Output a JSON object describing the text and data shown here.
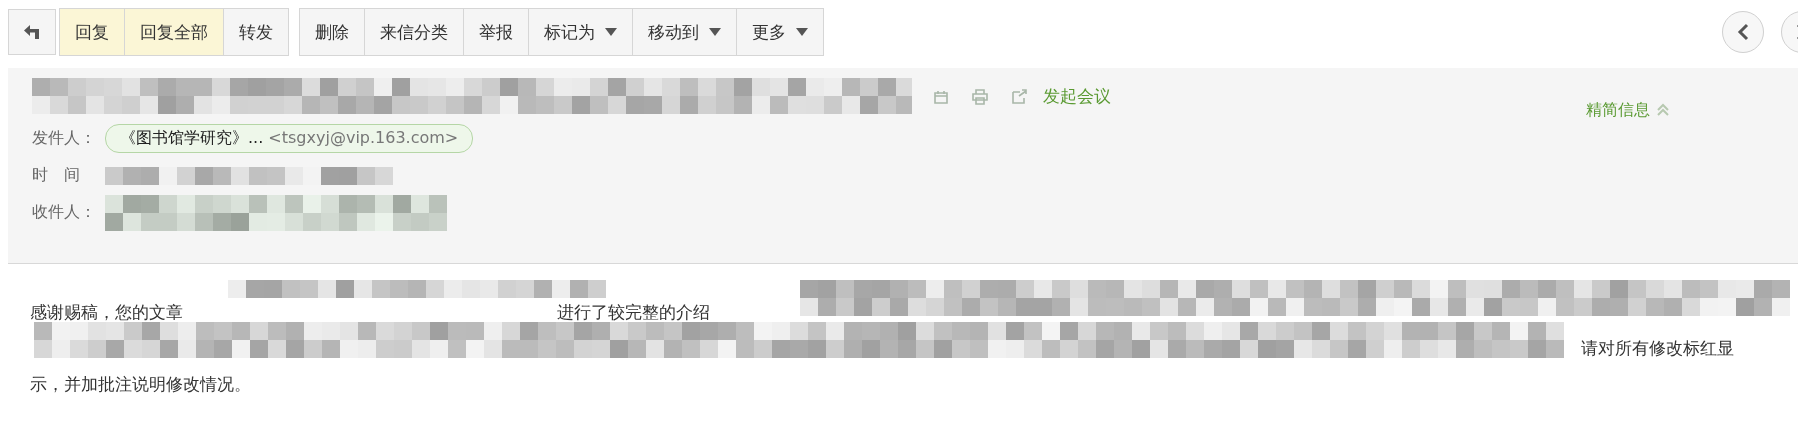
{
  "toolbar": {
    "groups": [
      [
        {
          "label": "回复",
          "highlighted": true,
          "dropdown": false
        },
        {
          "label": "回复全部",
          "highlighted": true,
          "dropdown": false
        },
        {
          "label": "转发",
          "highlighted": false,
          "dropdown": false
        }
      ],
      [
        {
          "label": "删除",
          "highlighted": false,
          "dropdown": false
        },
        {
          "label": "来信分类",
          "highlighted": false,
          "dropdown": false
        },
        {
          "label": "举报",
          "highlighted": false,
          "dropdown": false
        },
        {
          "label": "标记为",
          "highlighted": false,
          "dropdown": true
        },
        {
          "label": "移动到",
          "highlighted": false,
          "dropdown": true
        },
        {
          "label": "更多",
          "highlighted": false,
          "dropdown": true
        }
      ]
    ]
  },
  "header": {
    "meeting_link": "发起会议",
    "summary_toggle": {
      "label": "精简信息",
      "expanded": true
    },
    "fields": [
      {
        "label": "发件人：",
        "kind": "sender",
        "name": "《图书馆学研究》...",
        "address": "<tsgxyj@vip.163.com>"
      },
      {
        "label": "时　间",
        "kind": "redacted"
      },
      {
        "label": "收件人：",
        "kind": "redacted"
      }
    ]
  },
  "body": {
    "lines": [
      [
        "感谢赐稿，您的文章",
        "进行了较完整的介绍"
      ],
      [
        "请对所有修改标红显"
      ],
      [
        "示，并加批注说明修改情况。"
      ]
    ]
  }
}
